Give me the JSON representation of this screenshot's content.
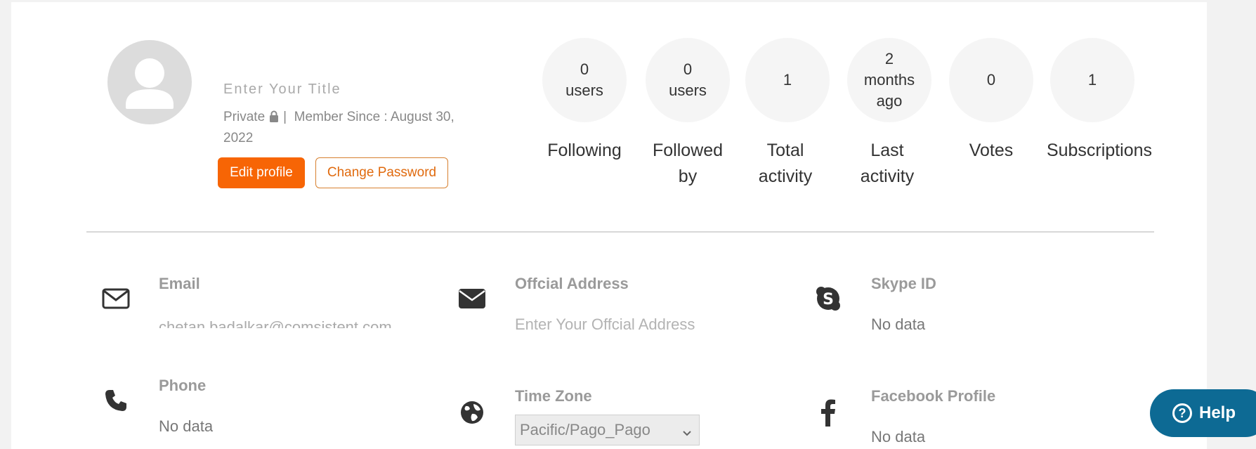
{
  "profile": {
    "title_partial": "Enter Your Title",
    "privacy": "Private",
    "separator": "|",
    "member_since": "Member Since : August 30, 2022",
    "edit_label": "Edit profile",
    "change_password_label": "Change Password"
  },
  "stats": [
    {
      "value_line1": "0",
      "value_line2": "users",
      "value_line3": "",
      "label": "Following"
    },
    {
      "value_line1": "0",
      "value_line2": "users",
      "value_line3": "",
      "label": "Followed by"
    },
    {
      "value_line1": "1",
      "value_line2": "",
      "value_line3": "",
      "label": "Total activity"
    },
    {
      "value_line1": "2",
      "value_line2": "months",
      "value_line3": "ago",
      "label": "Last activity"
    },
    {
      "value_line1": "0",
      "value_line2": "",
      "value_line3": "",
      "label": "Votes"
    },
    {
      "value_line1": "1",
      "value_line2": "",
      "value_line3": "",
      "label": "Subscriptions"
    }
  ],
  "info": {
    "email": {
      "title": "Email",
      "value": "chetan.badalkar@comsistent.com",
      "icon": "envelope-outline-icon"
    },
    "address": {
      "title": "Offcial Address",
      "placeholder": "Enter Your Offcial Address",
      "icon": "envelope-solid-icon"
    },
    "skype": {
      "title": "Skype ID",
      "value": "No data",
      "icon": "skype-icon"
    },
    "phone": {
      "title": "Phone",
      "value": "No data",
      "icon": "phone-icon"
    },
    "timezone": {
      "title": "Time Zone",
      "selected": "Pacific/Pago_Pago",
      "icon": "globe-icon"
    },
    "facebook": {
      "title": "Facebook Profile",
      "value": "No data",
      "icon": "facebook-icon"
    }
  },
  "help": {
    "label": "Help"
  },
  "colors": {
    "accent": "#f76505",
    "help_bg": "#0d6a94"
  }
}
